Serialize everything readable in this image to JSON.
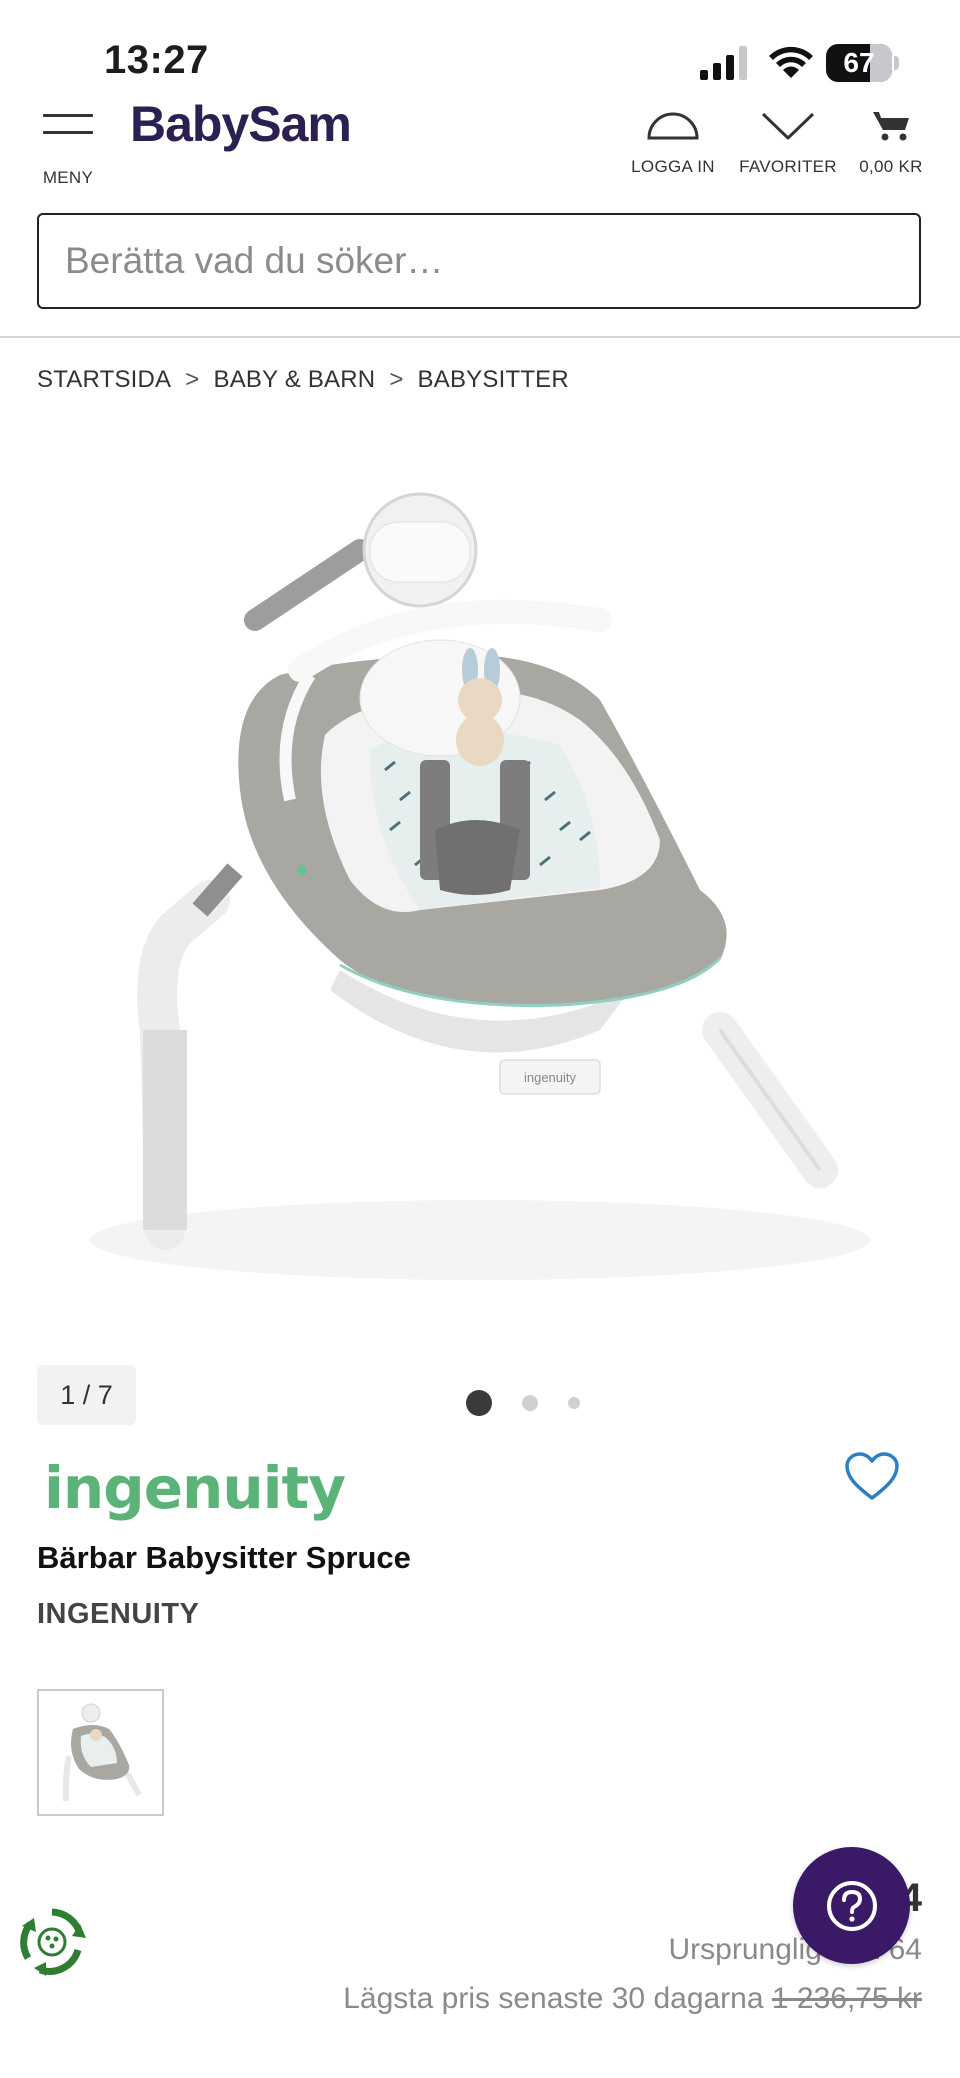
{
  "status_bar": {
    "time": "13:27",
    "battery": "67",
    "battery_level": 0.67
  },
  "header": {
    "logo": "BabySam",
    "menu_label": "MENY",
    "login_label": "LOGGA IN",
    "favorites_label": "FAVORITER",
    "cart_label": "0,00 KR"
  },
  "search": {
    "placeholder": "Berätta vad du söker…"
  },
  "breadcrumb": {
    "items": [
      "STARTSIDA",
      "BABY & BARN",
      "BABYSITTER"
    ],
    "separator": ">"
  },
  "gallery": {
    "counter": "1 / 7",
    "dot_count": 3,
    "active_dot": 0
  },
  "product": {
    "brand_logo": "ingenuity",
    "title": "Bärbar Babysitter Spruce",
    "brand": "INGENUITY",
    "price": "1 64",
    "original_price": "Ursprungligen 1 64",
    "lowest_label": "Lägsta pris senaste 30 dagarna",
    "lowest_value": "1 236,75 kr"
  },
  "colors": {
    "brand_navy": "#2c1f52",
    "help_purple": "#3a1a66",
    "ingenuity_green": "#5cb37a",
    "heart_blue": "#2a7fc4"
  },
  "icons": {
    "menu": "hamburger-icon",
    "login": "user-icon",
    "favorites": "heart-icon",
    "cart": "cart-icon",
    "help": "question-icon",
    "eco": "recycle-icon"
  }
}
